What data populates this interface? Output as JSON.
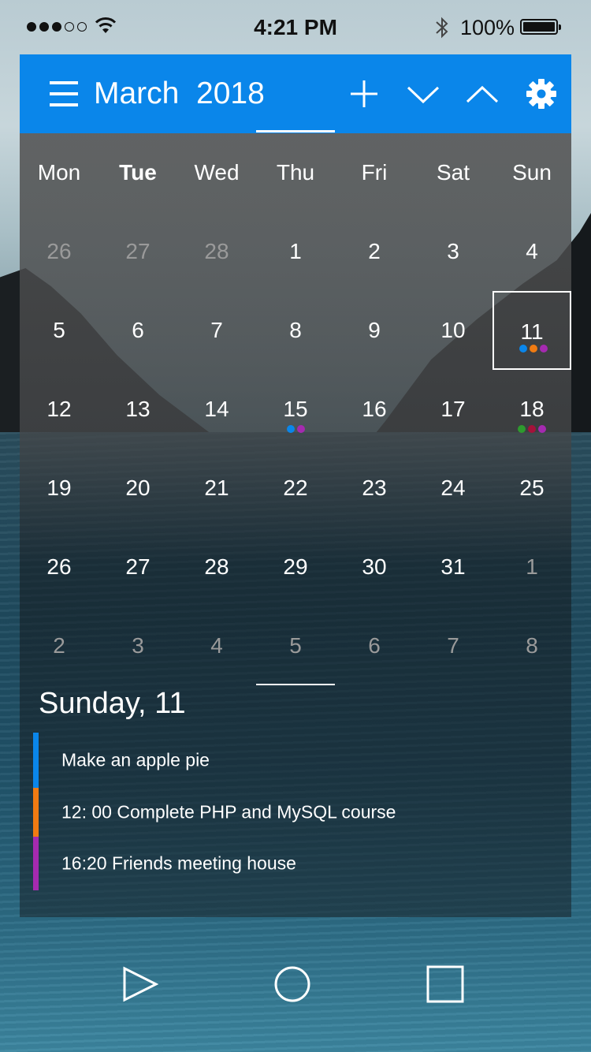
{
  "status_bar": {
    "time": "4:21 PM",
    "battery": "100%",
    "signal_dots_filled": 3,
    "signal_dots_total": 5
  },
  "header": {
    "title": "March  2018",
    "icons": [
      "menu-icon",
      "plus-icon",
      "chevron-down-icon",
      "chevron-up-icon",
      "gear-icon"
    ],
    "color": "#0a86ea"
  },
  "calendar": {
    "weekdays": [
      "Mon",
      "Tue",
      "Wed",
      "Thu",
      "Fri",
      "Sat",
      "Sun"
    ],
    "bold_weekday": "Tue",
    "weeks": [
      [
        {
          "d": "26",
          "m": true
        },
        {
          "d": "27",
          "m": true
        },
        {
          "d": "28",
          "m": true
        },
        {
          "d": "1"
        },
        {
          "d": "2"
        },
        {
          "d": "3"
        },
        {
          "d": "4"
        }
      ],
      [
        {
          "d": "5"
        },
        {
          "d": "6"
        },
        {
          "d": "7"
        },
        {
          "d": "8"
        },
        {
          "d": "9"
        },
        {
          "d": "10"
        },
        {
          "d": "11",
          "sel": true,
          "dots": [
            "#0a86ea",
            "#f07b12",
            "#a52ab0"
          ]
        }
      ],
      [
        {
          "d": "12"
        },
        {
          "d": "13"
        },
        {
          "d": "14"
        },
        {
          "d": "15",
          "dots": [
            "#0a86ea",
            "#a52ab0"
          ]
        },
        {
          "d": "16"
        },
        {
          "d": "17"
        },
        {
          "d": "18",
          "dots": [
            "#2e9a2e",
            "#a5123a",
            "#a52ab0"
          ]
        }
      ],
      [
        {
          "d": "19"
        },
        {
          "d": "20"
        },
        {
          "d": "21"
        },
        {
          "d": "22"
        },
        {
          "d": "23"
        },
        {
          "d": "24"
        },
        {
          "d": "25"
        }
      ],
      [
        {
          "d": "26"
        },
        {
          "d": "27"
        },
        {
          "d": "28"
        },
        {
          "d": "29"
        },
        {
          "d": "30"
        },
        {
          "d": "31"
        },
        {
          "d": "1",
          "m": true
        }
      ],
      [
        {
          "d": "2",
          "m": true
        },
        {
          "d": "3",
          "m": true
        },
        {
          "d": "4",
          "m": true
        },
        {
          "d": "5",
          "m": true
        },
        {
          "d": "6",
          "m": true
        },
        {
          "d": "7",
          "m": true
        },
        {
          "d": "8",
          "m": true
        }
      ]
    ]
  },
  "agenda": {
    "title": "Sunday, 11",
    "events": [
      {
        "text": "Make an apple pie",
        "color": "#0a86ea"
      },
      {
        "text": "12: 00 Complete PHP and MySQL course",
        "color": "#f07b12"
      },
      {
        "text": "16:20 Friends meeting house",
        "color": "#a52ab0"
      }
    ]
  },
  "nav": {
    "icons": [
      "back-triangle-icon",
      "home-circle-icon",
      "recents-square-icon"
    ]
  }
}
